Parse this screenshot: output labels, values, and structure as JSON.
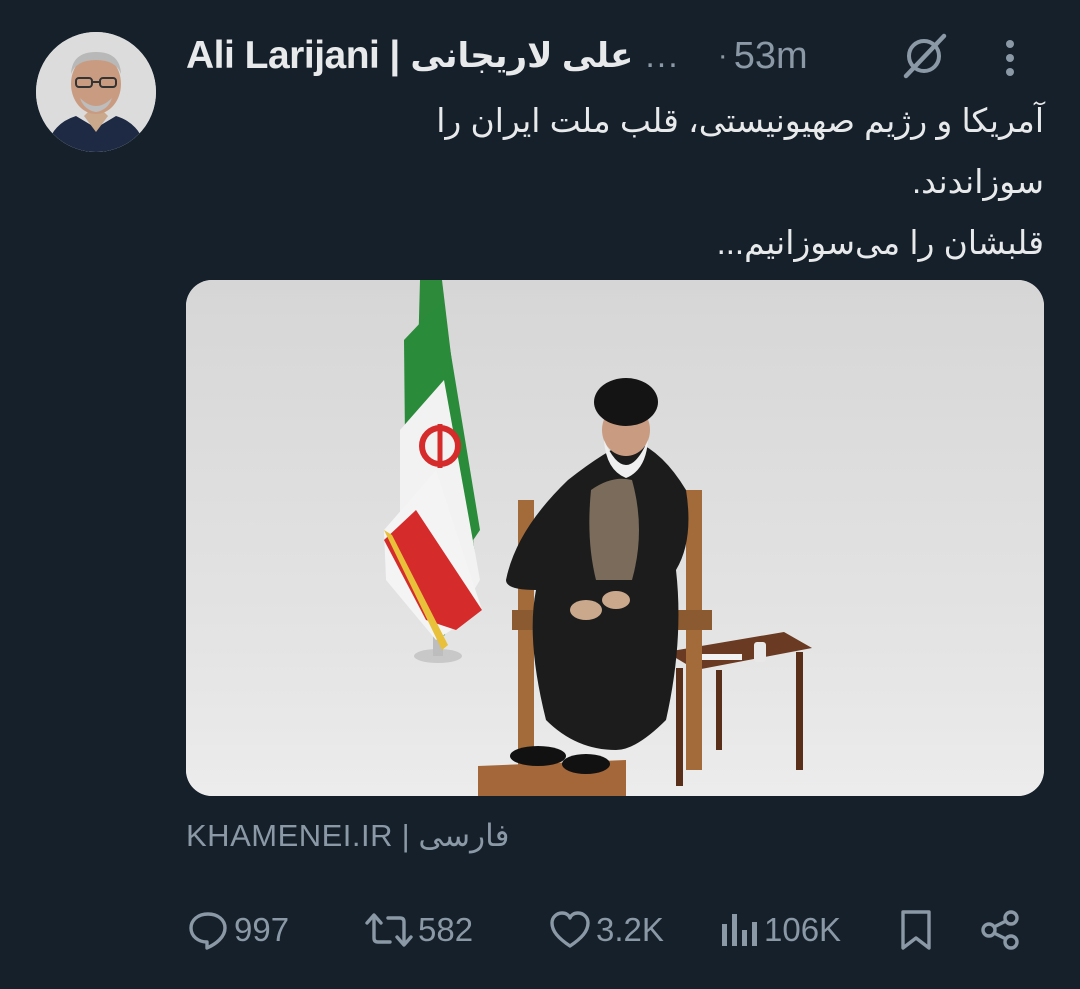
{
  "author": {
    "name_latin": "Ali Larijani",
    "separator": "|",
    "name_persian": "علی لاریجانی",
    "truncation": "...",
    "dot": "·",
    "time": "53m"
  },
  "tweet": {
    "lines": [
      "آمریکا و رژیم صهیونیستی، قلب ملت ایران را",
      "سوزاندند.",
      "قلبشان را می‌سوزانیم..."
    ]
  },
  "link_card": {
    "domain": "KHAMENEI.IR",
    "separator": "|",
    "language": "فارسی"
  },
  "actions": {
    "replies": "997",
    "reposts": "582",
    "likes": "3.2K",
    "views": "106K"
  },
  "icons": {
    "grok": "grok-icon",
    "more": "more-vertical-icon",
    "reply": "reply-icon",
    "repost": "repost-icon",
    "like": "heart-icon",
    "views": "views-icon",
    "bookmark": "bookmark-icon",
    "share": "share-icon"
  },
  "colors": {
    "background": "#15202b",
    "text_primary": "#e7e9ea",
    "text_secondary": "#8b98a5"
  }
}
